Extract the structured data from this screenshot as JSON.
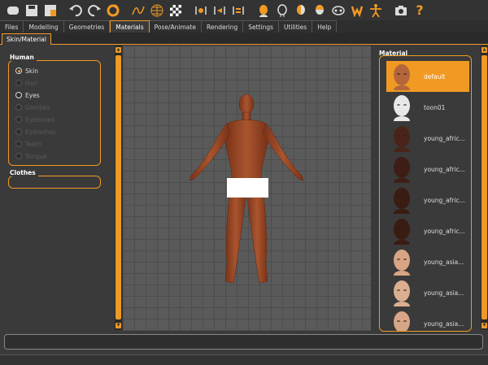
{
  "toolbar": {
    "buttons": [
      "window-icon",
      "save-icon",
      "export-icon",
      "undo-icon",
      "redo-icon",
      "reset-icon",
      "wireframe-icon",
      "grid-icon",
      "checker-icon",
      "front-view-icon",
      "back-view-icon",
      "side-view-icon",
      "head-icon",
      "neck-icon",
      "head-side-icon",
      "head-top-icon",
      "mask-icon",
      "hands-icon",
      "figure-icon",
      "screenshot-icon",
      "help-icon"
    ],
    "help_label": "?"
  },
  "tabs": [
    "Files",
    "Modelling",
    "Geometries",
    "Materials",
    "Pose/Animate",
    "Rendering",
    "Settings",
    "Utilities",
    "Help"
  ],
  "active_tab": "Materials",
  "subtab": "Skin/Material",
  "human": {
    "title": "Human",
    "items": [
      {
        "label": "Skin",
        "selected": true,
        "enabled": true
      },
      {
        "label": "Hair",
        "selected": false,
        "enabled": false
      },
      {
        "label": "Eyes",
        "selected": false,
        "enabled": true
      },
      {
        "label": "Genitals",
        "selected": false,
        "enabled": false
      },
      {
        "label": "Eyebrows",
        "selected": false,
        "enabled": false
      },
      {
        "label": "Eyelashes",
        "selected": false,
        "enabled": false
      },
      {
        "label": "Teeth",
        "selected": false,
        "enabled": false
      },
      {
        "label": "Tongue",
        "selected": false,
        "enabled": false
      }
    ]
  },
  "clothes": {
    "title": "Clothes"
  },
  "material": {
    "title": "Material",
    "items": [
      {
        "label": "default",
        "selected": true,
        "tone": "#b5653a"
      },
      {
        "label": "toon01",
        "selected": false,
        "tone": "#e8e8e8"
      },
      {
        "label": "young_afric...",
        "selected": false,
        "tone": "#4a2418"
      },
      {
        "label": "young_afric...",
        "selected": false,
        "tone": "#3e1e14"
      },
      {
        "label": "young_afric...",
        "selected": false,
        "tone": "#3a1c12"
      },
      {
        "label": "young_afric...",
        "selected": false,
        "tone": "#3a1c12"
      },
      {
        "label": "young_asia...",
        "selected": false,
        "tone": "#d8a483"
      },
      {
        "label": "young_asia...",
        "selected": false,
        "tone": "#dcae90"
      },
      {
        "label": "young_asia...",
        "selected": false,
        "tone": "#d6a686"
      }
    ]
  },
  "colors": {
    "accent": "#f09a24",
    "skin": "#a24e2c"
  }
}
